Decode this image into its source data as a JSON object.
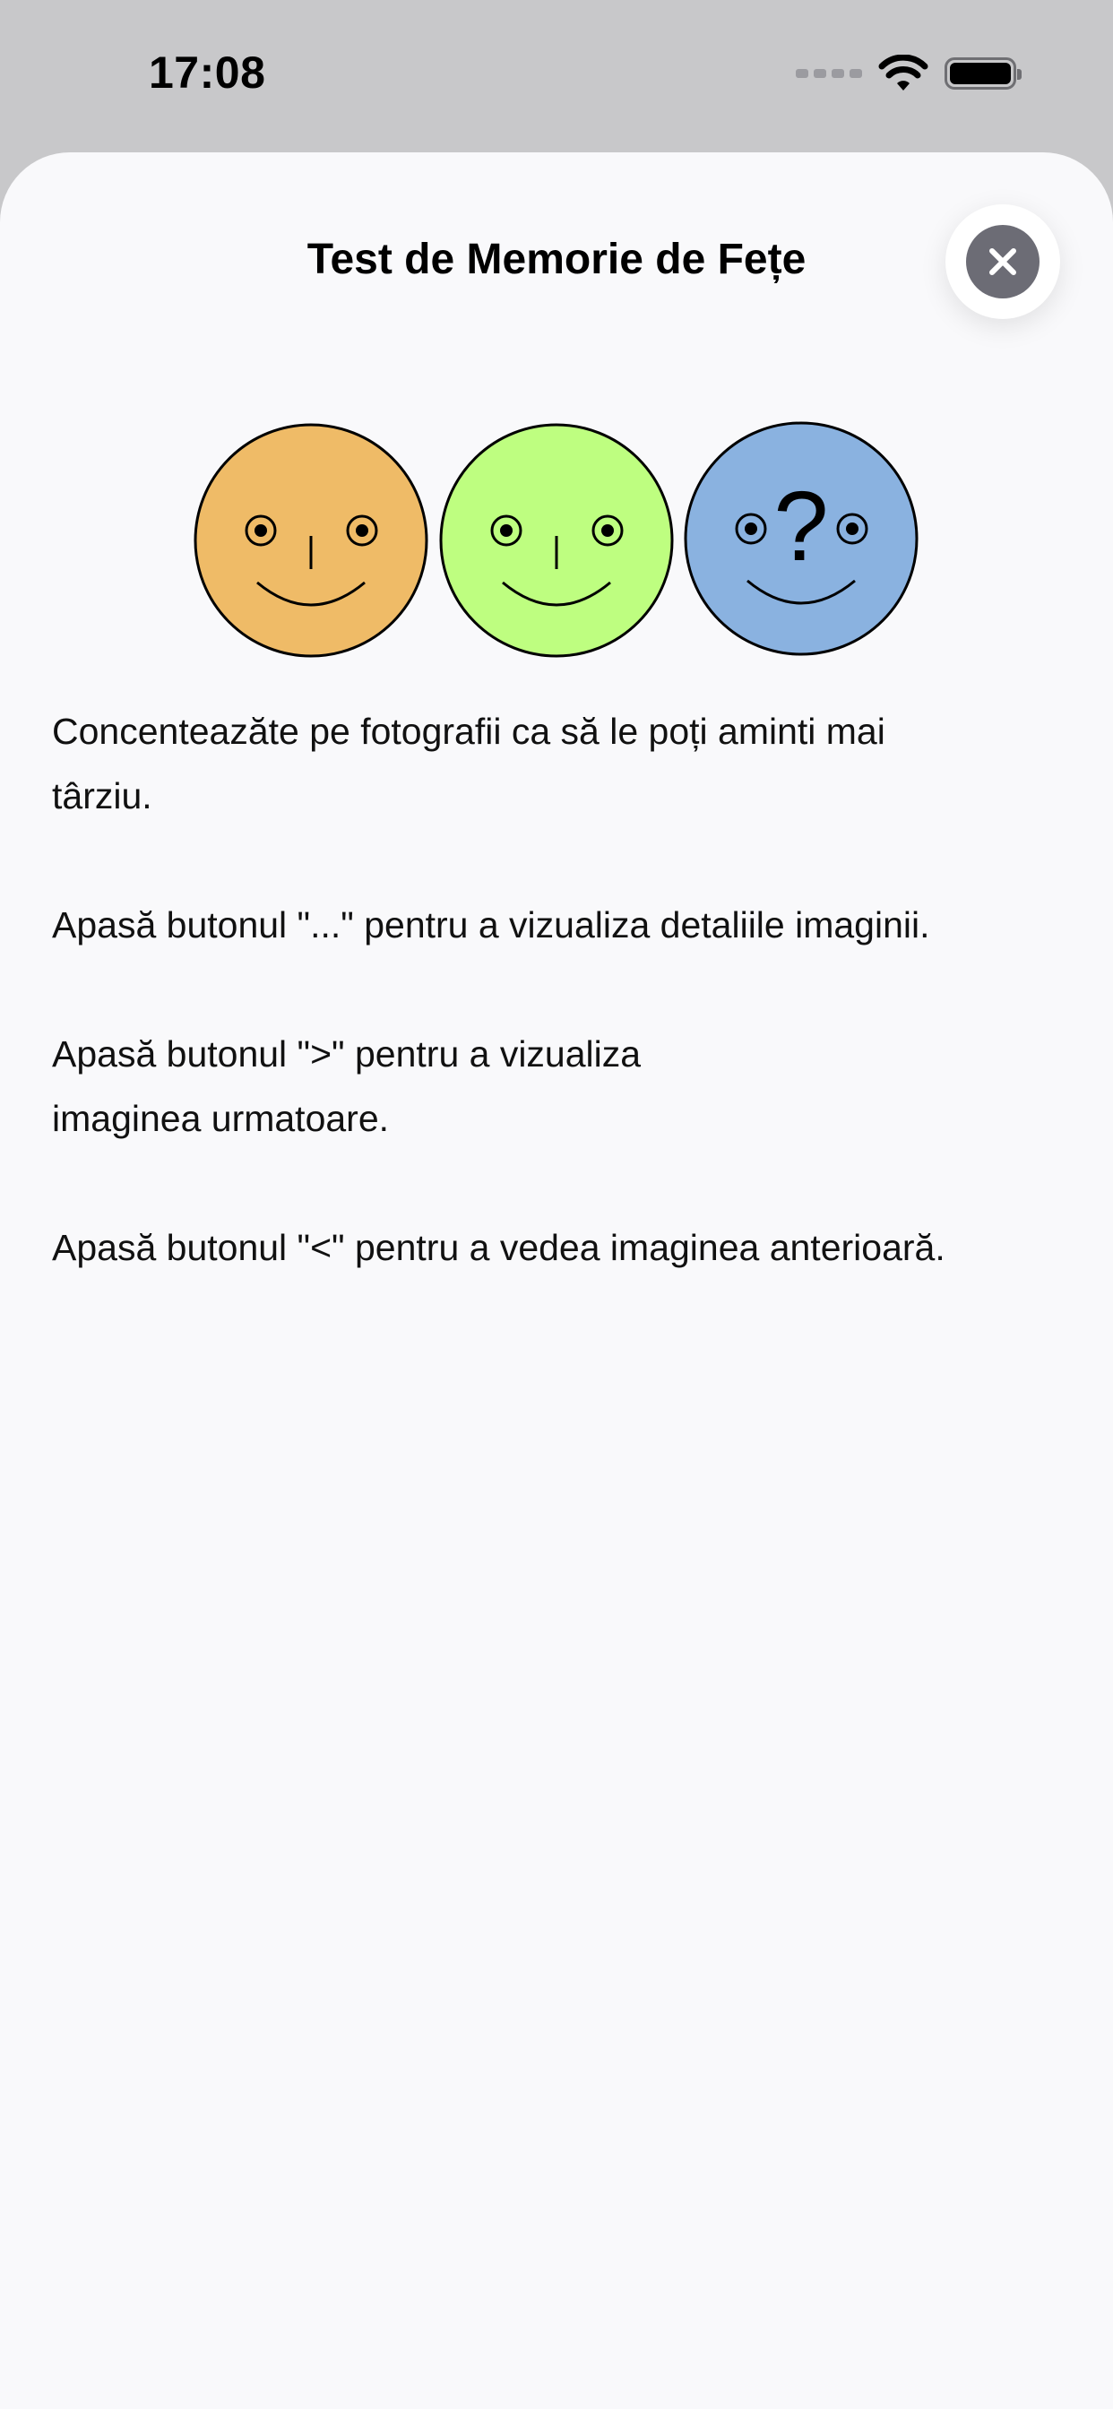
{
  "status_bar": {
    "time": "17:08"
  },
  "sheet": {
    "title": "Test de Memorie de Fețe",
    "close_icon": "xmark-circle-icon",
    "faces": [
      {
        "color": "#efbb67",
        "icon": "smiley-face-icon"
      },
      {
        "color": "#befe80",
        "icon": "smiley-face-icon"
      },
      {
        "color": "#8ab2e0",
        "icon": "question-face-icon",
        "mark": "?"
      }
    ],
    "instructions": [
      "Concenteazăte pe fotografii ca să le poți aminti mai târziu.",
      "Apasă butonul \"...\" pentru a vizualiza detaliile imaginii.",
      "Apasă butonul \">\" pentru a vizualiza imaginea urmatoare.",
      "Apasă butonul \"<\" pentru a vedea imaginea anterioară."
    ]
  },
  "colors": {
    "status_background": "#c8c8ca",
    "sheet_background": "#f9f9fb",
    "close_button": "#6c6c75"
  }
}
